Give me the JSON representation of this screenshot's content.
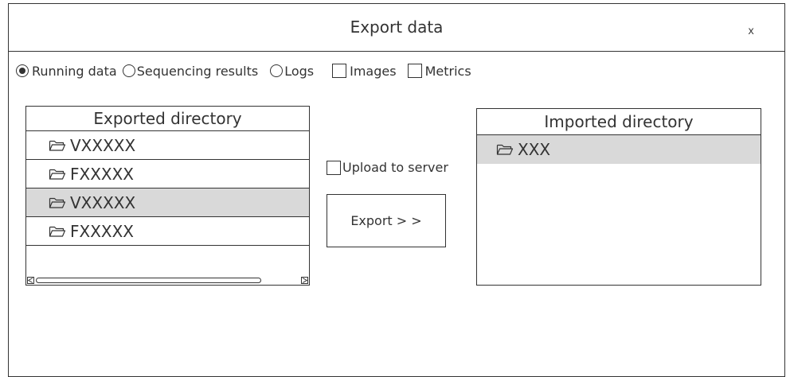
{
  "dialog": {
    "title": "Export data",
    "close_label": "x"
  },
  "options": {
    "running_data": {
      "label": "Running data",
      "selected": true
    },
    "sequencing_results": {
      "label": "Sequencing results",
      "selected": false
    },
    "logs": {
      "label": "Logs",
      "selected": false
    },
    "images": {
      "label": "Images",
      "checked": false
    },
    "metrics": {
      "label": "Metrics",
      "checked": false
    }
  },
  "exported": {
    "header": "Exported directory",
    "items": [
      {
        "label": "VXXXXX",
        "selected": false
      },
      {
        "label": "FXXXXX",
        "selected": false
      },
      {
        "label": "VXXXXX",
        "selected": true
      },
      {
        "label": "FXXXXX",
        "selected": false
      }
    ]
  },
  "upload": {
    "label": "Upload to server",
    "checked": false
  },
  "export_button": {
    "label": "Export > >"
  },
  "imported": {
    "header": "Imported directory",
    "items": [
      {
        "label": "XXX",
        "selected": true
      }
    ]
  },
  "colors": {
    "border": "#333333",
    "selected_row": "#d9d9d9",
    "text": "#333333"
  }
}
